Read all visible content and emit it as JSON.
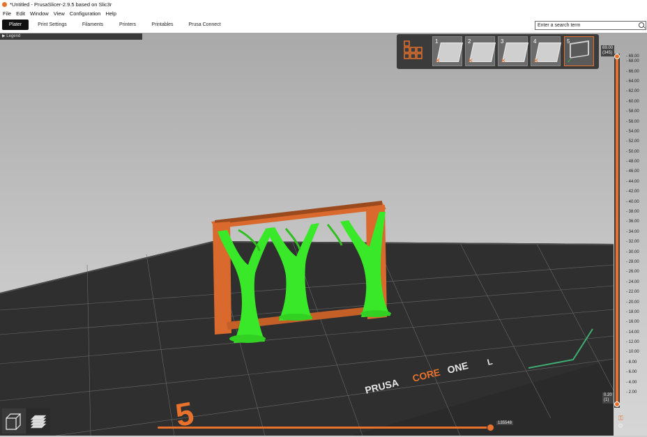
{
  "window": {
    "title": "*Untitled - PrusaSlicer-2.9.5 based on Slic3r"
  },
  "menu": {
    "items": [
      "File",
      "Edit",
      "Window",
      "View",
      "Configuration",
      "Help"
    ]
  },
  "tabs": [
    {
      "label": "Plater",
      "active": true
    },
    {
      "label": "Print Settings",
      "active": false
    },
    {
      "label": "Filaments",
      "active": false
    },
    {
      "label": "Printers",
      "active": false
    },
    {
      "label": "Printables",
      "active": false
    },
    {
      "label": "Prusa Connect",
      "active": false
    }
  ],
  "search": {
    "placeholder": "Enter a search term"
  },
  "legend": {
    "label": "Legend"
  },
  "objects": [
    {
      "number": "1",
      "status": "x"
    },
    {
      "number": "2",
      "status": "x"
    },
    {
      "number": "3",
      "status": "x"
    },
    {
      "number": "4",
      "status": "x"
    },
    {
      "number": "5",
      "status": "check"
    }
  ],
  "layer_slider": {
    "top_value": "69.00",
    "top_layer": "(345)",
    "bottom_value": "0.20",
    "bottom_layer": "(1)",
    "ticks": [
      "69.00",
      "68.00",
      "66.00",
      "64.00",
      "62.00",
      "60.00",
      "58.00",
      "56.00",
      "54.00",
      "52.00",
      "50.00",
      "48.00",
      "46.00",
      "44.00",
      "42.00",
      "40.00",
      "38.00",
      "36.00",
      "34.00",
      "32.00",
      "30.00",
      "28.00",
      "26.00",
      "24.00",
      "22.00",
      "20.00",
      "18.00",
      "16.00",
      "14.00",
      "12.00",
      "10.00",
      "8.00",
      "6.00",
      "4.00",
      "2.00"
    ]
  },
  "move_slider": {
    "value": "135548",
    "position_fraction": 1.0
  },
  "bed": {
    "brand_text_1": "PRUSA",
    "brand_text_2": "CORE",
    "brand_text_3": "ONE",
    "brand_text_4": "L",
    "bed_number": "5"
  },
  "colors": {
    "accent": "#e8722c",
    "support": "#33ee22",
    "model": "#d9692c"
  }
}
